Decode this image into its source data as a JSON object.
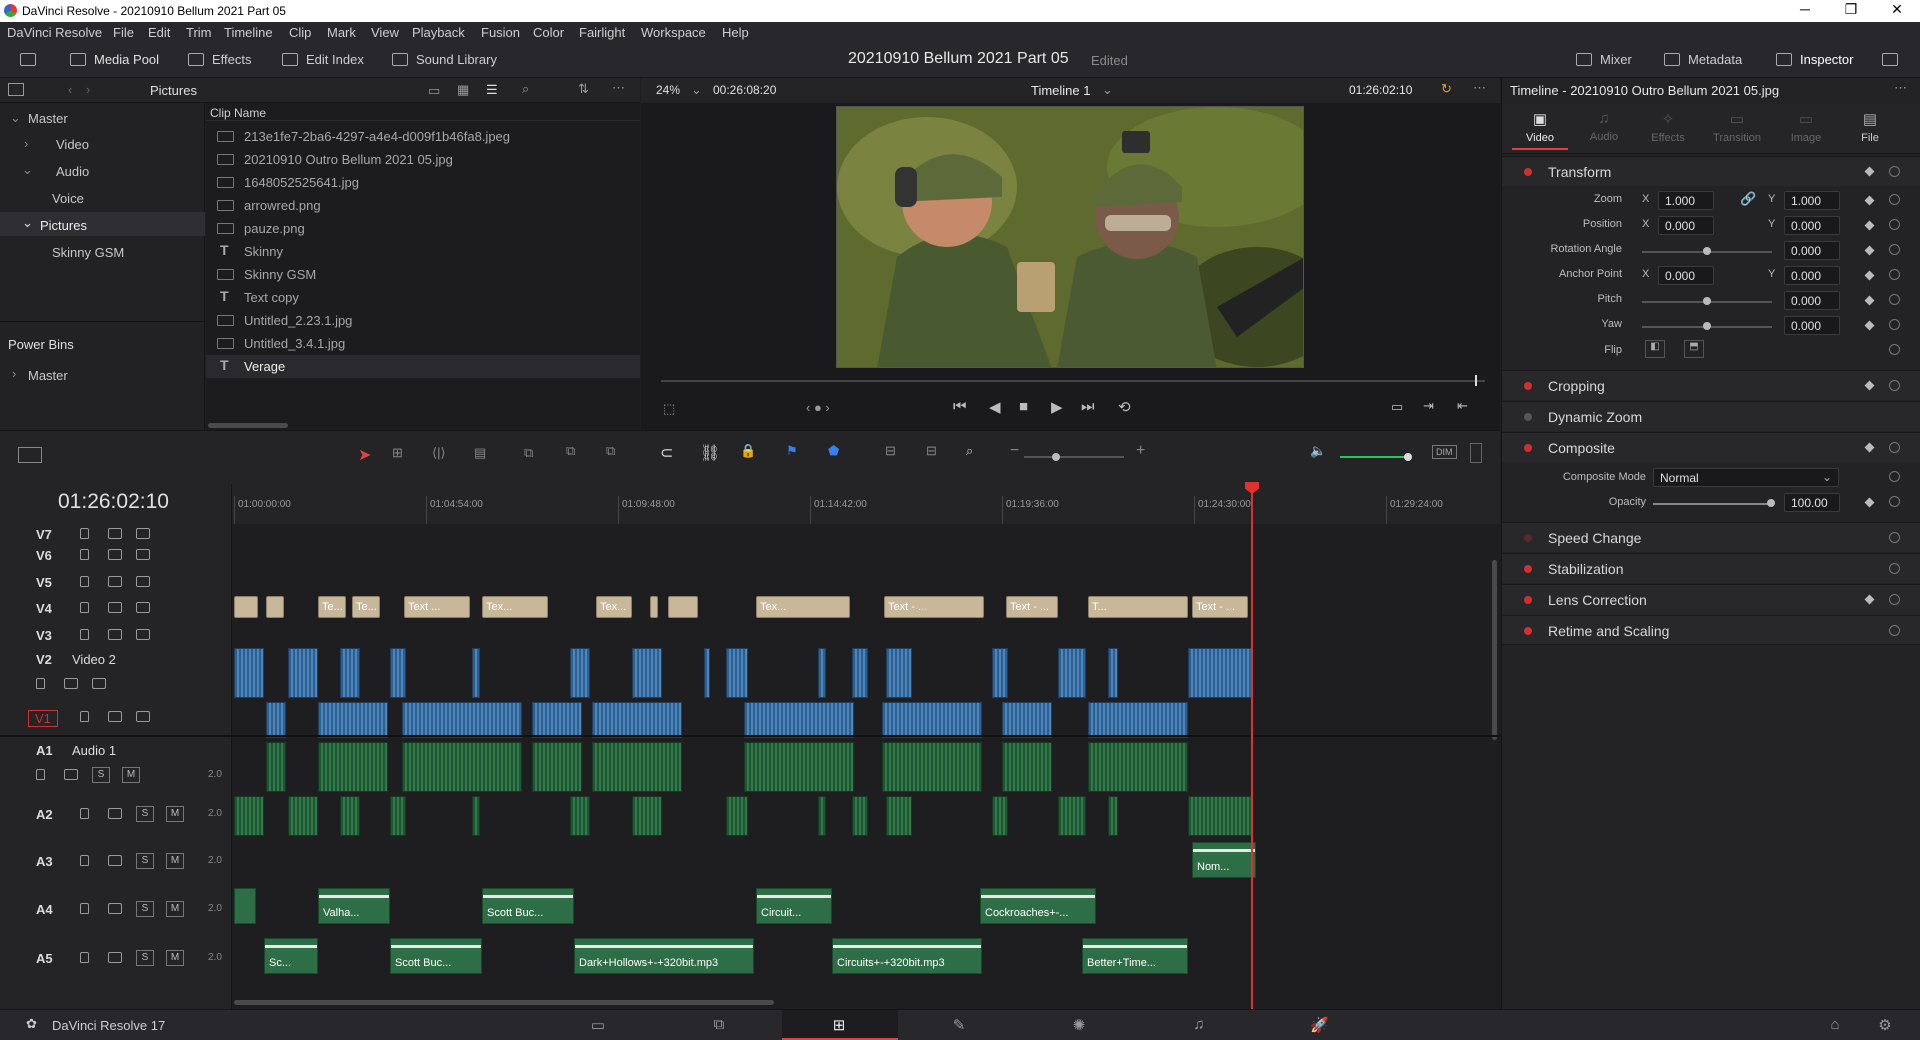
{
  "window": {
    "title": "DaVinci Resolve - 20210910 Bellum 2021 Part 05"
  },
  "menu": [
    "DaVinci Resolve",
    "File",
    "Edit",
    "Trim",
    "Timeline",
    "Clip",
    "Mark",
    "View",
    "Playback",
    "Fusion",
    "Color",
    "Fairlight",
    "Workspace",
    "Help"
  ],
  "toolbar": {
    "media_pool": "Media Pool",
    "effects": "Effects",
    "edit_index": "Edit Index",
    "sound_library": "Sound Library",
    "project_title": "20210910 Bellum 2021 Part 05",
    "edited": "Edited",
    "mixer": "Mixer",
    "metadata": "Metadata",
    "inspector": "Inspector"
  },
  "media_pool": {
    "path": "Pictures",
    "bins": [
      "Master",
      "Video",
      "Audio",
      "Voice",
      "Pictures",
      "Skinny GSM"
    ],
    "power_bins": "Power Bins",
    "power_master": "Master",
    "column": "Clip Name",
    "clips": [
      {
        "name": "213e1fe7-2ba6-4297-a4e4-d009f1b46fa8.jpeg",
        "type": "img"
      },
      {
        "name": "20210910 Outro Bellum 2021 05.jpg",
        "type": "img"
      },
      {
        "name": "1648052525641.jpg",
        "type": "img"
      },
      {
        "name": "arrowred.png",
        "type": "img"
      },
      {
        "name": "pauze.png",
        "type": "img"
      },
      {
        "name": "Skinny",
        "type": "text"
      },
      {
        "name": "Skinny GSM",
        "type": "img"
      },
      {
        "name": "Text copy",
        "type": "text"
      },
      {
        "name": "Untitled_2.23.1.jpg",
        "type": "img"
      },
      {
        "name": "Untitled_3.4.1.jpg",
        "type": "img"
      },
      {
        "name": "Verage",
        "type": "text"
      }
    ]
  },
  "viewer": {
    "zoom": "24%",
    "source_tc": "00:26:08:20",
    "timeline": "Timeline 1",
    "tc": "01:26:02:10"
  },
  "inspector": {
    "title": "Timeline - 20210910 Outro Bellum 2021 05.jpg",
    "tabs": [
      "Video",
      "Audio",
      "Effects",
      "Transition",
      "Image",
      "File"
    ],
    "transform": "Transform",
    "zoom_label": "Zoom",
    "zoom_x": "1.000",
    "zoom_y": "1.000",
    "position_label": "Position",
    "pos_x": "0.000",
    "pos_y": "0.000",
    "rotation_label": "Rotation Angle",
    "rotation": "0.000",
    "anchor_label": "Anchor Point",
    "anchor_x": "0.000",
    "anchor_y": "0.000",
    "pitch_label": "Pitch",
    "pitch": "0.000",
    "yaw_label": "Yaw",
    "yaw": "0.000",
    "flip_label": "Flip",
    "x": "X",
    "y": "Y",
    "cropping": "Cropping",
    "dynamic_zoom": "Dynamic Zoom",
    "composite": "Composite",
    "composite_mode_label": "Composite Mode",
    "composite_mode": "Normal",
    "opacity_label": "Opacity",
    "opacity": "100.00",
    "speed_change": "Speed Change",
    "stabilization": "Stabilization",
    "lens_correction": "Lens Correction",
    "retime": "Retime and Scaling"
  },
  "timeline": {
    "tc": "01:26:02:10",
    "ruler": [
      "01:00:00:00",
      "01:04:54:00",
      "01:09:48:00",
      "01:14:42:00",
      "01:19:36:00",
      "01:24:30:00",
      "01:29:24:00"
    ],
    "v2_name": "Video 2",
    "a1_name": "Audio 1",
    "tracks": [
      "V7",
      "V6",
      "V5",
      "V4",
      "V3",
      "V2",
      "V1",
      "A1",
      "A2",
      "A3",
      "A4",
      "A5"
    ],
    "ch": "2.0",
    "s": "S",
    "m": "M",
    "text_clips": [
      "Te...",
      "Te...",
      "Text ...",
      "Tex...",
      "Tex...",
      "Tex...",
      "Text - ...",
      "Text - ...",
      "T...",
      "Text - ...",
      "Te..."
    ],
    "audio_clips": [
      "Nom...",
      "Valha...",
      "Scott Buc...",
      "Circuit...",
      "Cockroaches+-...",
      "Sc...",
      "Scott Buc...",
      "Dark+Hollows+-+320bit.mp3",
      "Circuits+-+320bit.mp3",
      "Better+Time..."
    ]
  },
  "footer": {
    "app": "DaVinci Resolve 17"
  }
}
